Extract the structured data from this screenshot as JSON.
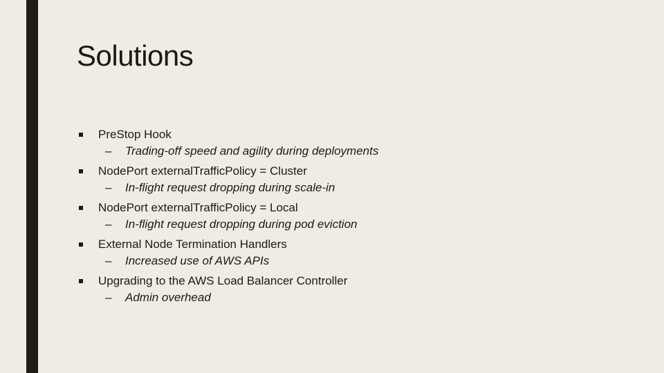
{
  "slide": {
    "title": "Solutions",
    "items": [
      {
        "marker": "▪",
        "text": "PreStop Hook",
        "sub": {
          "marker": "–",
          "text": "Trading-off speed and agility during deployments"
        }
      },
      {
        "marker": "▪",
        "text": "NodePort externalTrafficPolicy = Cluster",
        "sub": {
          "marker": "–",
          "text": "In-flight request dropping during scale-in"
        }
      },
      {
        "marker": "▪",
        "text": "NodePort externalTrafficPolicy = Local",
        "sub": {
          "marker": "–",
          "text": "In-flight request dropping during pod eviction"
        }
      },
      {
        "marker": "▪",
        "text": "External Node Termination Handlers",
        "sub": {
          "marker": "–",
          "text": "Increased use of AWS APIs"
        }
      },
      {
        "marker": "▪",
        "text": "Upgrading to the AWS Load Balancer Controller",
        "sub": {
          "marker": "–",
          "text": "Admin overhead"
        }
      }
    ]
  },
  "colors": {
    "background": "#eeece4",
    "accent_bar": "#1c1e14",
    "text": "#1a1a14"
  }
}
